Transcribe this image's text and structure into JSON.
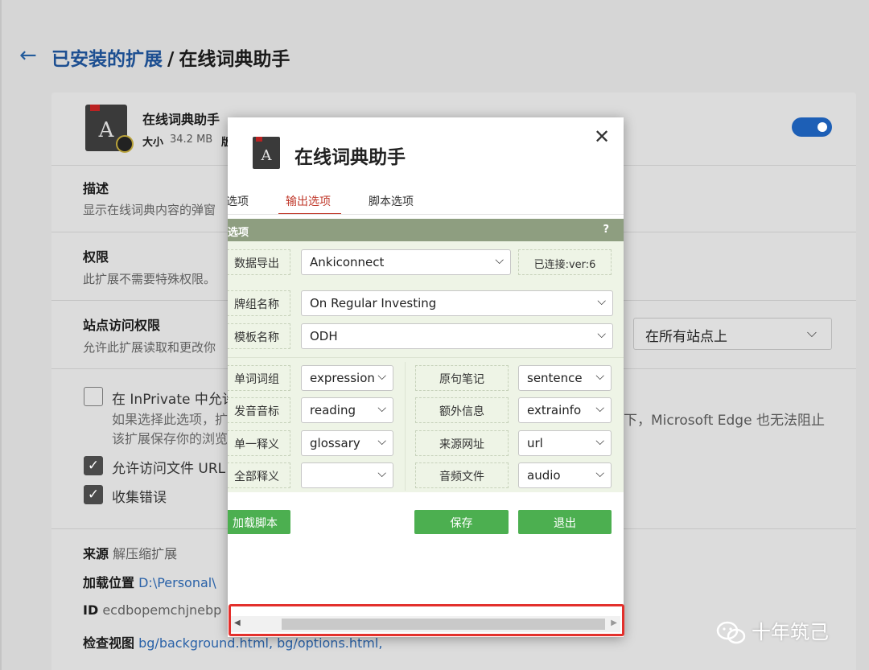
{
  "header": {
    "back_icon": "left-arrow-icon",
    "breadcrumb_link": "已安装的扩展",
    "breadcrumb_sep": "/",
    "breadcrumb_current": "在线词典助手"
  },
  "extension": {
    "name": "在线词典助手",
    "size_label": "大小",
    "size_value": "34.2 MB",
    "size_more": "版",
    "enabled": true
  },
  "sections": {
    "desc_title": "描述",
    "desc_text": "显示在线词典内容的弹窗",
    "perm_title": "权限",
    "perm_text": "此扩展不需要特殊权限。",
    "site_title": "站点访问权限",
    "site_text": "允许此扩展读取和更改你",
    "site_select": "在所有站点上"
  },
  "checkboxes": {
    "inprivate_label": "在 InPrivate 中允许",
    "inprivate_checked": false,
    "inprivate_sub1": "如果选择此选项，扩",
    "inprivate_sub2": "该扩展保存你的浏览",
    "right_text": "下，Microsoft Edge 也无法阻止",
    "file_url_label": "允许访问文件 URL",
    "file_url_checked": true,
    "errors_label": "收集错误",
    "errors_checked": true
  },
  "source": {
    "src_label": "来源",
    "src_value": "解压缩扩展",
    "load_label": "加载位置",
    "load_value": "D:\\Personal\\",
    "id_label": "ID",
    "id_value": "ecdbopemchjnebp",
    "views_label": "检查视图",
    "views_value": "bg/background.html,  bg/options.html,"
  },
  "popup": {
    "title": "在线词典助手",
    "close_icon": "close-icon",
    "tabs": [
      "选项",
      "输出选项",
      "脚本选项"
    ],
    "active_tab": "输出选项",
    "panel_title": "选项",
    "help": "?",
    "rows": {
      "export_label": "数据导出",
      "export_value": "Ankiconnect",
      "connected": "已连接:ver:6",
      "deck_label": "牌组名称",
      "deck_value": "On Regular Investing",
      "model_label": "模板名称",
      "model_value": "ODH"
    },
    "fields_left": [
      {
        "label": "单词词组",
        "value": "expression"
      },
      {
        "label": "发音音标",
        "value": "reading"
      },
      {
        "label": "单一释义",
        "value": "glossary"
      },
      {
        "label": "全部释义",
        "value": ""
      }
    ],
    "fields_right": [
      {
        "label": "原句笔记",
        "value": "sentence"
      },
      {
        "label": "额外信息",
        "value": "extrainfo"
      },
      {
        "label": "来源网址",
        "value": "url"
      },
      {
        "label": "音频文件",
        "value": "audio"
      }
    ],
    "buttons": {
      "reload": "加载脚本",
      "save": "保存",
      "exit": "退出"
    },
    "accent_color": "#4caf50"
  },
  "watermark": "十年筑己"
}
